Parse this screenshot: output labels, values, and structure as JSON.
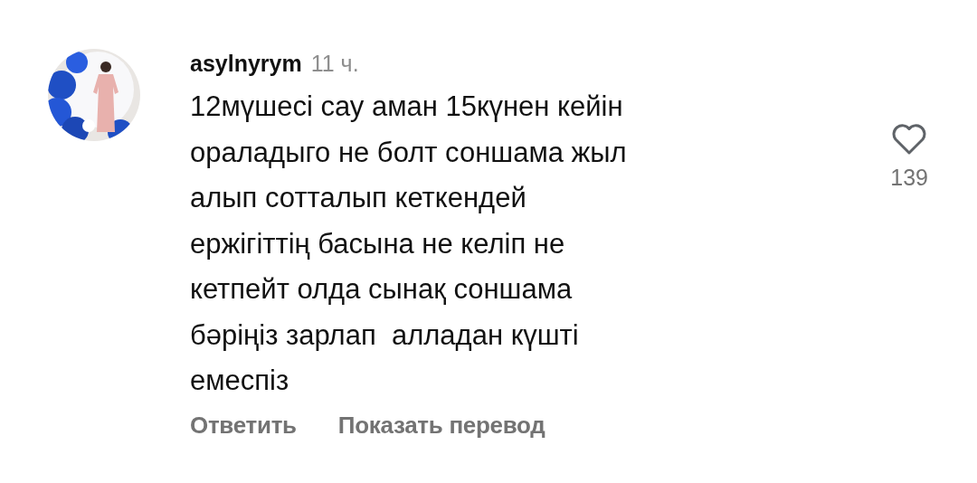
{
  "comment": {
    "username": "asylnyrym",
    "time": "11 ч.",
    "text": "12мүшесі сау аман 15күнен кейін\nораладыго не болт соншама жыл\nалып сотталып кеткендей\nержігіттің басына не келіп не\nкетпейт олда сынақ соншама\nбәріңіз зарлап  алладан күшті\nемеспіз",
    "liked": false,
    "like_count": "139",
    "actions": [
      "Ответить",
      "Показать перевод"
    ]
  }
}
